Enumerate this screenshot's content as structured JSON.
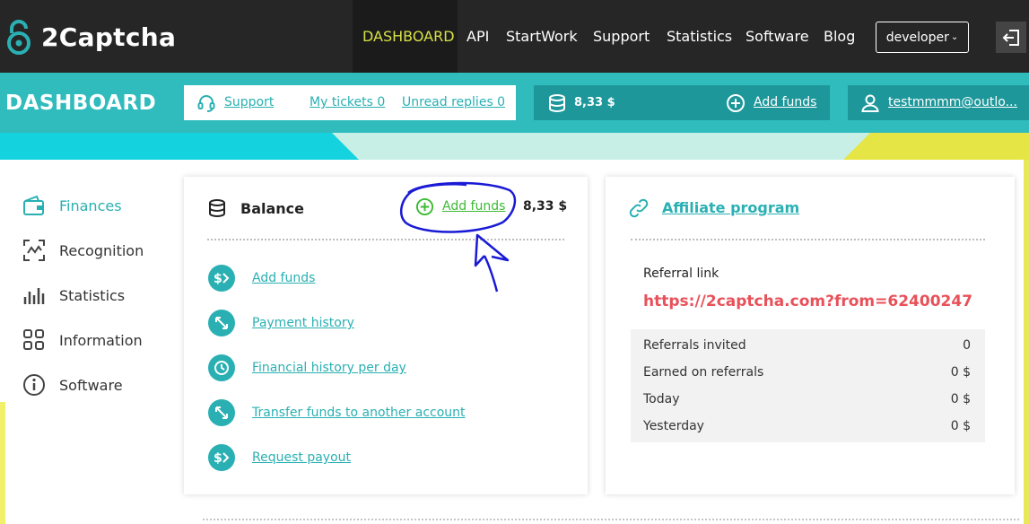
{
  "brand": {
    "name": "2Captcha"
  },
  "nav": {
    "items": [
      "DASHBOARD",
      "API",
      "StartWork",
      "Support",
      "Statistics",
      "Software",
      "Blog"
    ],
    "active": "DASHBOARD",
    "role_select": "developer"
  },
  "band": {
    "title": "DASHBOARD",
    "support": "Support",
    "my_tickets": "My tickets 0",
    "unread_replies": "Unread replies 0",
    "balance": "8,33 $",
    "add_funds": "Add funds",
    "user_email": "testmmmm@outlo..."
  },
  "sidebar": {
    "items": [
      {
        "label": "Finances",
        "icon": "wallet-icon",
        "active": true
      },
      {
        "label": "Recognition",
        "icon": "recognition-icon"
      },
      {
        "label": "Statistics",
        "icon": "bar-chart-icon"
      },
      {
        "label": "Information",
        "icon": "grid-icon"
      },
      {
        "label": "Software",
        "icon": "info-icon"
      }
    ]
  },
  "balance_card": {
    "title": "Balance",
    "add_funds": "Add funds",
    "value": "8,33 $",
    "actions": [
      {
        "label": "Add funds",
        "icon": "dollar-arrow-icon"
      },
      {
        "label": "Payment history",
        "icon": "arrows-icon"
      },
      {
        "label": "Financial history per day",
        "icon": "history-icon"
      },
      {
        "label": "Transfer funds to another account",
        "icon": "arrows-icon"
      },
      {
        "label": "Request payout",
        "icon": "dollar-arrow-icon"
      }
    ]
  },
  "affiliate_card": {
    "title": "Affiliate program",
    "referral_label": "Referral link",
    "referral_link": "https://2captcha.com?from=62400247",
    "stats": [
      {
        "label": "Referrals invited",
        "value": "0"
      },
      {
        "label": "Earned on referrals",
        "value": "0 $"
      },
      {
        "label": "Today",
        "value": "0 $"
      },
      {
        "label": "Yesterday",
        "value": "0 $"
      }
    ]
  },
  "colors": {
    "teal": "#30bbbd",
    "dark_teal": "#1d979a",
    "link": "#2ab0b3",
    "nav_active": "#d7e146",
    "green": "#3cba34",
    "ref_red": "#e8515a",
    "annotation_blue": "#1a1ad6"
  }
}
